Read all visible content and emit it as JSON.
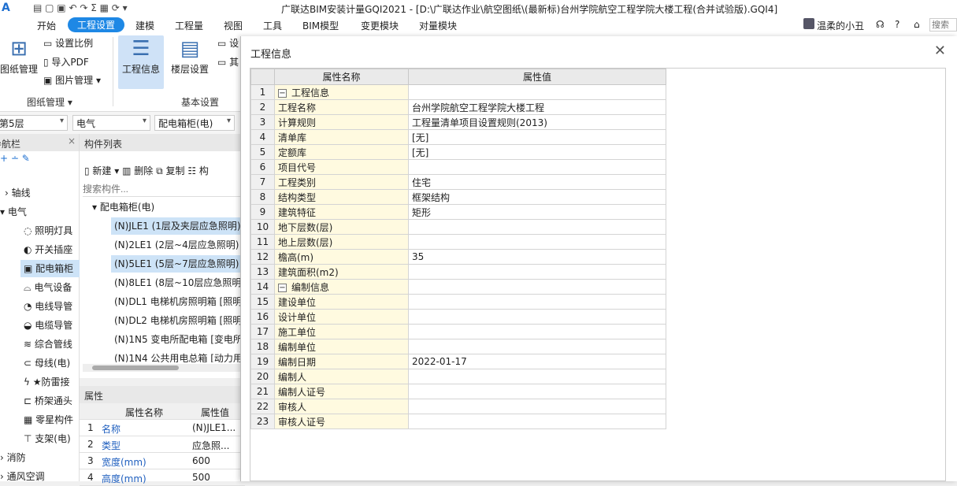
{
  "titlebar": {
    "title": "广联达BIM安装计量GQI2021 - [D:\\广联达作业\\航空图纸\\(最新标)台州学院航空工程学院大楼工程(合并试验版).GQI4]"
  },
  "menu": {
    "items": [
      "开始",
      "工程设置",
      "建模",
      "工程量",
      "视图",
      "工具",
      "BIM模型",
      "变更模块",
      "对量模块"
    ],
    "user": "温柔的小丑",
    "help": "?",
    "search_placeholder": "搜索"
  },
  "ribbon": {
    "drawing_mgmt": "图纸管理",
    "set_scale": "设置比例",
    "import_pdf": "导入PDF",
    "image_mgmt": "图片管理",
    "project_info": "工程信息",
    "floor_settings": "楼层设置",
    "settings_cut": "设",
    "other_cut": "其",
    "group_drawing": "图纸管理",
    "group_basic": "基本设置"
  },
  "dropdowns": {
    "floor": "第5层",
    "discipline": "电气",
    "type": "配电箱柜(电)"
  },
  "nav": {
    "header": "导航栏",
    "items": [
      {
        "label": "轴线",
        "icon": "caret-icon"
      },
      {
        "label": "电气",
        "icon": "caret-icon"
      },
      {
        "label": "照明灯具",
        "icon": "bulb-icon"
      },
      {
        "label": "开关插座",
        "icon": "switch-icon"
      },
      {
        "label": "配电箱柜",
        "icon": "box-icon"
      },
      {
        "label": "电气设备",
        "icon": "device-icon"
      },
      {
        "label": "电线导管",
        "icon": "wire-icon"
      },
      {
        "label": "电缆导管",
        "icon": "cable-icon"
      },
      {
        "label": "综合管线",
        "icon": "pipe-icon"
      },
      {
        "label": "母线(电)",
        "icon": "busbar-icon"
      },
      {
        "label": "★防雷接",
        "icon": "lightning-icon"
      },
      {
        "label": "桥架通头",
        "icon": "tray-icon"
      },
      {
        "label": "零星构件",
        "icon": "grid-icon"
      },
      {
        "label": "支架(电)",
        "icon": "bracket-icon"
      },
      {
        "label": "消防",
        "icon": "caret-icon"
      },
      {
        "label": "通风空调",
        "icon": "caret-icon"
      }
    ]
  },
  "complist": {
    "header": "构件列表",
    "new": "新建",
    "delete": "删除",
    "copy": "复制",
    "more": "构",
    "search_placeholder": "搜索构件...",
    "group": "配电箱柜(电)",
    "items": [
      "(N)JLE1 (1层及夹层应急照明)",
      "(N)2LE1 (2层~4层应急照明)",
      "(N)5LE1 (5层~7层应急照明)",
      "(N)8LE1 (8层~10层应急照明)",
      "(N)DL1 电梯机房照明箱 [照明",
      "(N)DL2 电梯机房照明箱 [照明",
      "(N)1N5 变电所配电箱 [变电所",
      "(N)1N4 公共用电总箱 [动力用"
    ]
  },
  "props": {
    "header": "属性",
    "col_name": "属性名称",
    "col_value": "属性值",
    "rows": [
      {
        "num": "1",
        "name": "名称",
        "value": "(N)JLE1..."
      },
      {
        "num": "2",
        "name": "类型",
        "value": "应急照..."
      },
      {
        "num": "3",
        "name": "宽度(mm)",
        "value": "600"
      },
      {
        "num": "4",
        "name": "高度(mm)",
        "value": "500"
      }
    ]
  },
  "dialog": {
    "title": "工程信息",
    "col_name": "属性名称",
    "col_value": "属性值",
    "rows": [
      {
        "num": "1",
        "name": "工程信息",
        "value": "",
        "group": true
      },
      {
        "num": "2",
        "name": "工程名称",
        "value": "台州学院航空工程学院大楼工程"
      },
      {
        "num": "3",
        "name": "计算规则",
        "value": "工程量清单项目设置规则(2013)"
      },
      {
        "num": "4",
        "name": "清单库",
        "value": "[无]"
      },
      {
        "num": "5",
        "name": "定额库",
        "value": "[无]"
      },
      {
        "num": "6",
        "name": "项目代号",
        "value": ""
      },
      {
        "num": "7",
        "name": "工程类别",
        "value": "住宅"
      },
      {
        "num": "8",
        "name": "结构类型",
        "value": "框架结构"
      },
      {
        "num": "9",
        "name": "建筑特征",
        "value": "矩形"
      },
      {
        "num": "10",
        "name": "地下层数(层)",
        "value": ""
      },
      {
        "num": "11",
        "name": "地上层数(层)",
        "value": ""
      },
      {
        "num": "12",
        "name": "檐高(m)",
        "value": "35"
      },
      {
        "num": "13",
        "name": "建筑面积(m2)",
        "value": ""
      },
      {
        "num": "14",
        "name": "编制信息",
        "value": "",
        "group": true
      },
      {
        "num": "15",
        "name": "建设单位",
        "value": ""
      },
      {
        "num": "16",
        "name": "设计单位",
        "value": ""
      },
      {
        "num": "17",
        "name": "施工单位",
        "value": ""
      },
      {
        "num": "18",
        "name": "编制单位",
        "value": ""
      },
      {
        "num": "19",
        "name": "编制日期",
        "value": "2022-01-17"
      },
      {
        "num": "20",
        "name": "编制人",
        "value": ""
      },
      {
        "num": "21",
        "name": "编制人证号",
        "value": ""
      },
      {
        "num": "22",
        "name": "审核人",
        "value": ""
      },
      {
        "num": "23",
        "name": "审核人证号",
        "value": ""
      }
    ]
  },
  "colors": {
    "accent": "#1e88e5",
    "name_cell": "#fffae0",
    "selection": "#cde3f7"
  }
}
